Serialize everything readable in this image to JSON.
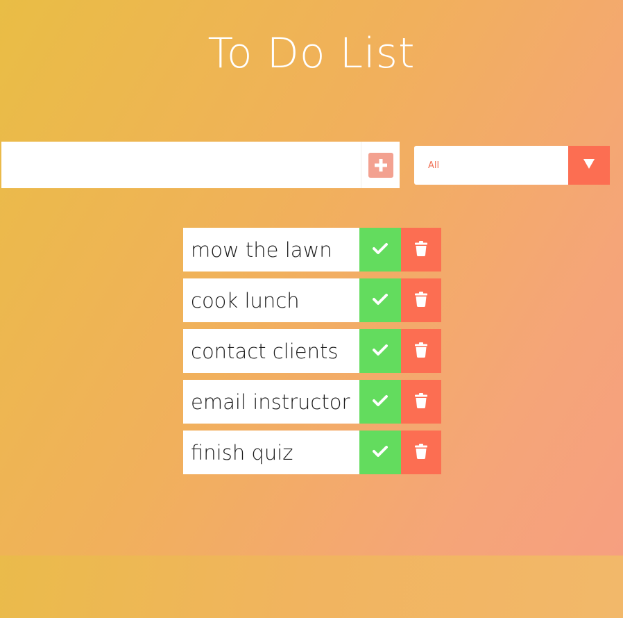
{
  "header": {
    "title": "To Do List"
  },
  "form": {
    "input_value": "",
    "input_placeholder": "",
    "add_icon": "plus-square-icon"
  },
  "filter": {
    "selected": "All",
    "arrow_icon": "caret-down-icon"
  },
  "todos": [
    {
      "text": "mow the lawn"
    },
    {
      "text": "cook lunch"
    },
    {
      "text": "contact clients"
    },
    {
      "text": "email instructor"
    },
    {
      "text": "finish quiz"
    }
  ],
  "colors": {
    "complete": "#63dc5e",
    "delete": "#fc6e52",
    "add_button": "#f3a190",
    "filter_text": "#f07055"
  }
}
